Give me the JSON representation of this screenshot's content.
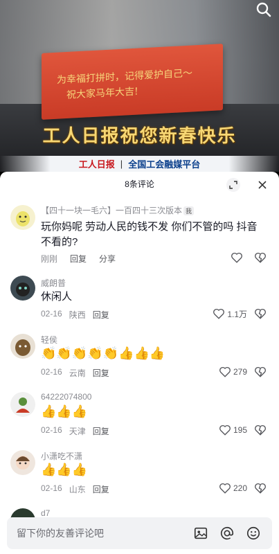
{
  "video": {
    "card_line1": "为幸福打拼时，记得爱护自己～",
    "card_line2": "祝大家马年大吉!",
    "blessing": "工人日报祝您新春快乐",
    "brand": "工人日报",
    "separator": "|",
    "platform": "全国工会融媒平台"
  },
  "sheet": {
    "title": "8条评论"
  },
  "comments": [
    {
      "username": "【四十一块一毛六】一百四十三次版本",
      "tag": "我",
      "text": "玩你妈呢  劳动人民的钱不发 你们不管的吗 抖音不看的?",
      "time": "刚刚",
      "location": "",
      "reply": "回复",
      "share": "分享",
      "likes": ""
    },
    {
      "username": "威朗普",
      "text": "休闲人",
      "time": "02-16",
      "location": "陕西",
      "reply": "回复",
      "likes": "1.1万"
    },
    {
      "username": "轻侯",
      "emojis": "👏👏👏👏👏👍👍👍",
      "time": "02-16",
      "location": "云南",
      "reply": "回复",
      "likes": "279"
    },
    {
      "username": "64222074800",
      "emojis": "👍👍👍",
      "time": "02-16",
      "location": "天津",
      "reply": "回复",
      "likes": "195"
    },
    {
      "username": "小潇吃不潇",
      "emojis": "👍👍👍",
      "time": "02-16",
      "location": "山东",
      "reply": "回复",
      "likes": "220"
    },
    {
      "username": "d7"
    }
  ],
  "input": {
    "placeholder": "留下你的友善评论吧"
  },
  "colors": {
    "accent_red": "#c8171d",
    "platform_blue": "#0a3f8c",
    "card_red": "#d8452d",
    "gold": "#f7d774"
  }
}
